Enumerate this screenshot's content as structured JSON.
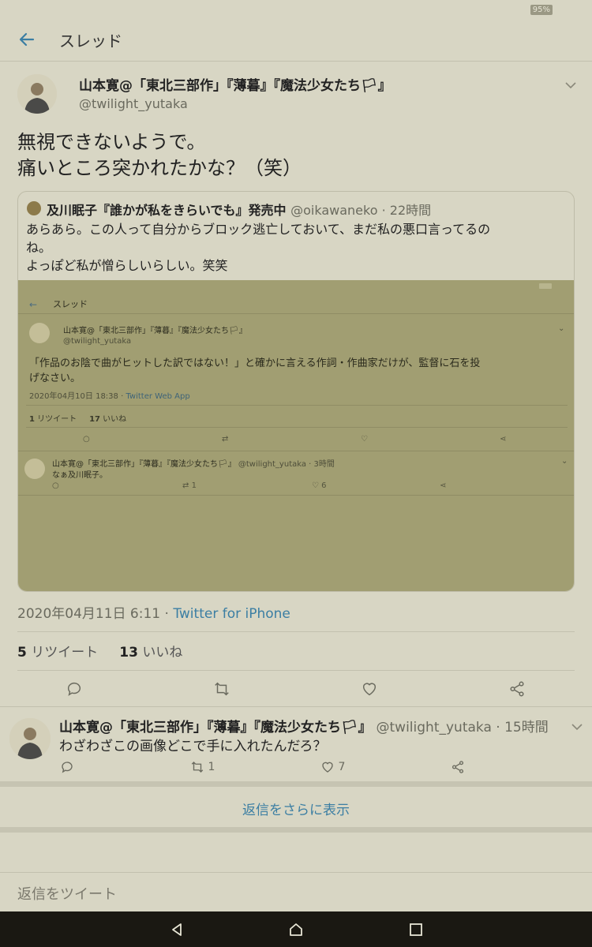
{
  "status_bar": {
    "battery": "95%"
  },
  "header": {
    "title": "スレッド",
    "back_icon": "arrow-left-icon"
  },
  "tweet": {
    "author_name": "山本寛@「東北三部作」『薄暮』『魔法少女たち🏳』",
    "handle": "@twilight_yutaka",
    "text_line1": "無視できないようで。",
    "text_line2": "痛いところ突かれたかな？（笑）",
    "date": "2020年04月11日 6:11",
    "via": "Twitter for iPhone",
    "retweets_count": "5",
    "retweets_label": "リツイート",
    "likes_count": "13",
    "likes_label": "いいね"
  },
  "quote": {
    "author_name": "及川眠子『誰かが私をきらいでも』発売中",
    "handle": "@oikawaneko",
    "time": "22時間",
    "line1": "あらあら。この人って自分からブロック逃亡しておいて、まだ私の悪口言ってるの",
    "line2": "ね。",
    "line3": "よっぽど私が憎らしいらしい。笑笑",
    "screenshot": {
      "title": "スレッド",
      "author_name": "山本寛@「東北三部作」『薄暮』『魔法少女たち🏳』",
      "handle": "@twilight_yutaka",
      "text_line1": "「作品のお陰で曲がヒットした訳ではない！」と確かに言える作詞・作曲家だけが、監督に石を投",
      "text_line2": "げなさい。",
      "date": "2020年04月10日 18:38",
      "via": "Twitter Web App",
      "retweets_count": "1",
      "retweets_label": "リツイート",
      "likes_count": "17",
      "likes_label": "いいね",
      "reply_author": "山本寛@「東北三部作」『薄暮』『魔法少女たち🏳』",
      "reply_handle": "@twilight_yutaka",
      "reply_time": "3時間",
      "reply_text": "なぁ及川眠子。",
      "reply_retweets": "1",
      "reply_likes": "6"
    }
  },
  "reply": {
    "author_name": "山本寛@「東北三部作」『薄暮』『魔法少女たち🏳』",
    "handle": "@twilight_yutaka",
    "time": "15時間",
    "text": "わざわざこの画像どこで手に入れたんだろ？",
    "retweets": "1",
    "likes": "7"
  },
  "show_more_replies": "返信をさらに表示",
  "reply_placeholder": "返信をツイート",
  "colors": {
    "background": "#d8d6c4",
    "link": "#3b7ea3",
    "navbar": "#1a1812"
  }
}
